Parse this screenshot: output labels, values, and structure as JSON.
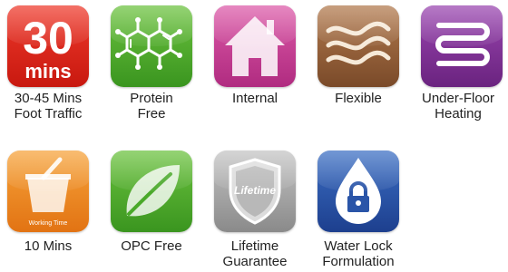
{
  "icons": [
    {
      "icon": "thirty-mins-icon",
      "color": "#e1261c",
      "badge_number": "30",
      "badge_unit": "mins",
      "label": [
        "30-45 Mins",
        "Foot Traffic"
      ]
    },
    {
      "icon": "molecule-icon",
      "color": "#4aa92a",
      "label": [
        "Protein",
        "Free"
      ]
    },
    {
      "icon": "house-icon",
      "color": "#c2398f",
      "label": [
        "Internal"
      ]
    },
    {
      "icon": "wavy-lines-icon",
      "color": "#8c5a36",
      "label": [
        "Flexible"
      ]
    },
    {
      "icon": "heating-coil-icon",
      "color": "#7b2f91",
      "label": [
        "Under-Floor",
        "Heating"
      ]
    },
    {
      "icon": "bucket-icon",
      "color": "#f08a24",
      "caption": "Working Time",
      "label": [
        "10 Mins"
      ]
    },
    {
      "icon": "leaf-icon",
      "color": "#4aa92a",
      "label": [
        "OPC Free"
      ]
    },
    {
      "icon": "shield-icon",
      "color": "#9a9a9a",
      "caption": "Lifetime",
      "label": [
        "Lifetime",
        "Guarantee"
      ]
    },
    {
      "icon": "padlock-drop-icon",
      "color": "#2a55a8",
      "label": [
        "Water Lock",
        "Formulation"
      ]
    }
  ]
}
